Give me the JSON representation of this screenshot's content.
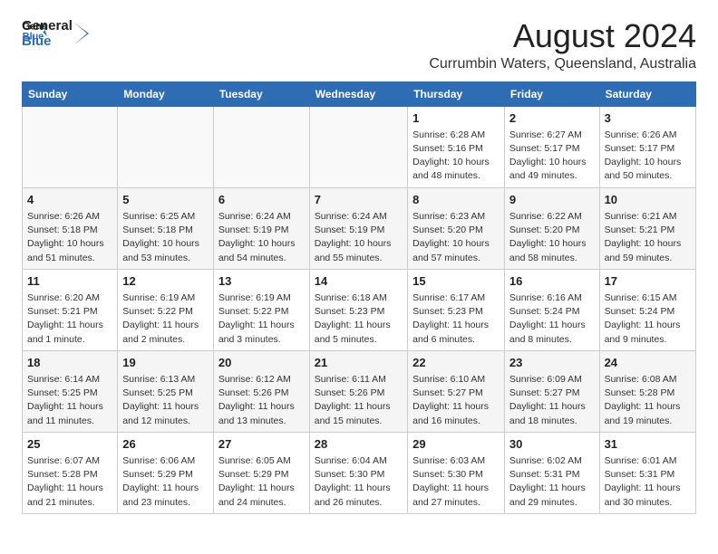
{
  "logo": {
    "line1": "General",
    "line2": "Blue"
  },
  "title": "August 2024",
  "subtitle": "Currumbin Waters, Queensland, Australia",
  "days_of_week": [
    "Sunday",
    "Monday",
    "Tuesday",
    "Wednesday",
    "Thursday",
    "Friday",
    "Saturday"
  ],
  "weeks": [
    [
      {
        "day": "",
        "info": ""
      },
      {
        "day": "",
        "info": ""
      },
      {
        "day": "",
        "info": ""
      },
      {
        "day": "",
        "info": ""
      },
      {
        "day": "1",
        "info": "Sunrise: 6:28 AM\nSunset: 5:16 PM\nDaylight: 10 hours\nand 48 minutes."
      },
      {
        "day": "2",
        "info": "Sunrise: 6:27 AM\nSunset: 5:17 PM\nDaylight: 10 hours\nand 49 minutes."
      },
      {
        "day": "3",
        "info": "Sunrise: 6:26 AM\nSunset: 5:17 PM\nDaylight: 10 hours\nand 50 minutes."
      }
    ],
    [
      {
        "day": "4",
        "info": "Sunrise: 6:26 AM\nSunset: 5:18 PM\nDaylight: 10 hours\nand 51 minutes."
      },
      {
        "day": "5",
        "info": "Sunrise: 6:25 AM\nSunset: 5:18 PM\nDaylight: 10 hours\nand 53 minutes."
      },
      {
        "day": "6",
        "info": "Sunrise: 6:24 AM\nSunset: 5:19 PM\nDaylight: 10 hours\nand 54 minutes."
      },
      {
        "day": "7",
        "info": "Sunrise: 6:24 AM\nSunset: 5:19 PM\nDaylight: 10 hours\nand 55 minutes."
      },
      {
        "day": "8",
        "info": "Sunrise: 6:23 AM\nSunset: 5:20 PM\nDaylight: 10 hours\nand 57 minutes."
      },
      {
        "day": "9",
        "info": "Sunrise: 6:22 AM\nSunset: 5:20 PM\nDaylight: 10 hours\nand 58 minutes."
      },
      {
        "day": "10",
        "info": "Sunrise: 6:21 AM\nSunset: 5:21 PM\nDaylight: 10 hours\nand 59 minutes."
      }
    ],
    [
      {
        "day": "11",
        "info": "Sunrise: 6:20 AM\nSunset: 5:21 PM\nDaylight: 11 hours\nand 1 minute."
      },
      {
        "day": "12",
        "info": "Sunrise: 6:19 AM\nSunset: 5:22 PM\nDaylight: 11 hours\nand 2 minutes."
      },
      {
        "day": "13",
        "info": "Sunrise: 6:19 AM\nSunset: 5:22 PM\nDaylight: 11 hours\nand 3 minutes."
      },
      {
        "day": "14",
        "info": "Sunrise: 6:18 AM\nSunset: 5:23 PM\nDaylight: 11 hours\nand 5 minutes."
      },
      {
        "day": "15",
        "info": "Sunrise: 6:17 AM\nSunset: 5:23 PM\nDaylight: 11 hours\nand 6 minutes."
      },
      {
        "day": "16",
        "info": "Sunrise: 6:16 AM\nSunset: 5:24 PM\nDaylight: 11 hours\nand 8 minutes."
      },
      {
        "day": "17",
        "info": "Sunrise: 6:15 AM\nSunset: 5:24 PM\nDaylight: 11 hours\nand 9 minutes."
      }
    ],
    [
      {
        "day": "18",
        "info": "Sunrise: 6:14 AM\nSunset: 5:25 PM\nDaylight: 11 hours\nand 11 minutes."
      },
      {
        "day": "19",
        "info": "Sunrise: 6:13 AM\nSunset: 5:25 PM\nDaylight: 11 hours\nand 12 minutes."
      },
      {
        "day": "20",
        "info": "Sunrise: 6:12 AM\nSunset: 5:26 PM\nDaylight: 11 hours\nand 13 minutes."
      },
      {
        "day": "21",
        "info": "Sunrise: 6:11 AM\nSunset: 5:26 PM\nDaylight: 11 hours\nand 15 minutes."
      },
      {
        "day": "22",
        "info": "Sunrise: 6:10 AM\nSunset: 5:27 PM\nDaylight: 11 hours\nand 16 minutes."
      },
      {
        "day": "23",
        "info": "Sunrise: 6:09 AM\nSunset: 5:27 PM\nDaylight: 11 hours\nand 18 minutes."
      },
      {
        "day": "24",
        "info": "Sunrise: 6:08 AM\nSunset: 5:28 PM\nDaylight: 11 hours\nand 19 minutes."
      }
    ],
    [
      {
        "day": "25",
        "info": "Sunrise: 6:07 AM\nSunset: 5:28 PM\nDaylight: 11 hours\nand 21 minutes."
      },
      {
        "day": "26",
        "info": "Sunrise: 6:06 AM\nSunset: 5:29 PM\nDaylight: 11 hours\nand 23 minutes."
      },
      {
        "day": "27",
        "info": "Sunrise: 6:05 AM\nSunset: 5:29 PM\nDaylight: 11 hours\nand 24 minutes."
      },
      {
        "day": "28",
        "info": "Sunrise: 6:04 AM\nSunset: 5:30 PM\nDaylight: 11 hours\nand 26 minutes."
      },
      {
        "day": "29",
        "info": "Sunrise: 6:03 AM\nSunset: 5:30 PM\nDaylight: 11 hours\nand 27 minutes."
      },
      {
        "day": "30",
        "info": "Sunrise: 6:02 AM\nSunset: 5:31 PM\nDaylight: 11 hours\nand 29 minutes."
      },
      {
        "day": "31",
        "info": "Sunrise: 6:01 AM\nSunset: 5:31 PM\nDaylight: 11 hours\nand 30 minutes."
      }
    ]
  ]
}
